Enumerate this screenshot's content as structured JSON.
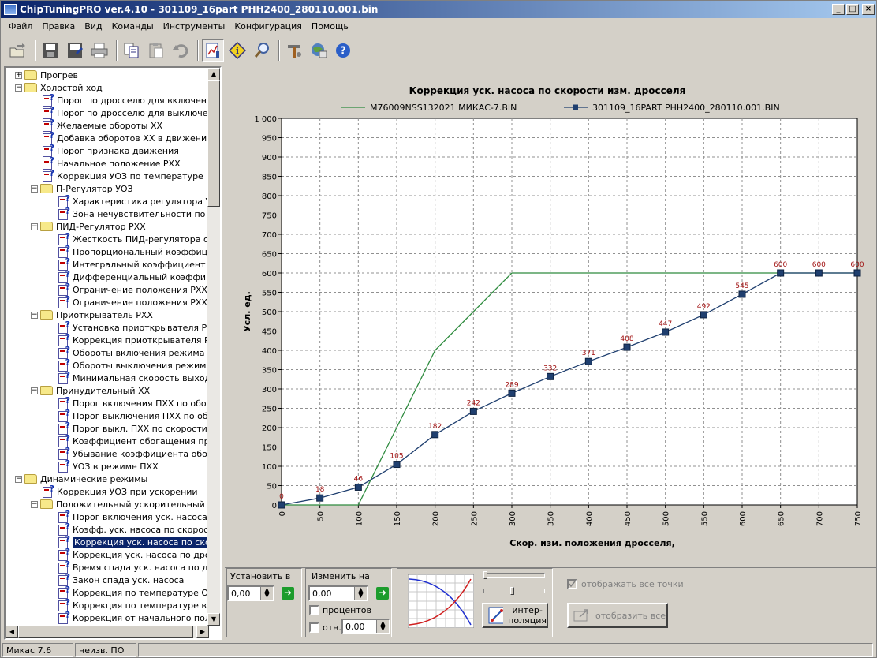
{
  "window": {
    "title": "ChipTuningPRO ver.4.10 - 301109_16part РНН2400_280110.001.bin",
    "controls": [
      "_",
      "□",
      "×"
    ]
  },
  "menu": [
    "Файл",
    "Правка",
    "Вид",
    "Команды",
    "Инструменты",
    "Конфигурация",
    "Помощь"
  ],
  "toolbar": [
    "open-icon",
    "save-icon",
    "save-as-icon",
    "print-icon",
    "copy-icon",
    "paste-icon",
    "undo-icon",
    "chart-icon",
    "info-icon",
    "zoom-icon",
    "tools-icon",
    "network-icon",
    "help-icon"
  ],
  "tree": [
    {
      "level": 0,
      "type": "folder",
      "expander": "+",
      "label": "Прогрев"
    },
    {
      "level": 0,
      "type": "folder",
      "expander": "−",
      "label": "Холостой ход"
    },
    {
      "level": 1,
      "type": "param",
      "label": "Порог по дросселю для включени"
    },
    {
      "level": 1,
      "type": "param",
      "label": "Порог по дросселю для выключен"
    },
    {
      "level": 1,
      "type": "param",
      "label": "Желаемые обороты ХХ"
    },
    {
      "level": 1,
      "type": "param",
      "label": "Добавка оборотов ХХ в движени"
    },
    {
      "level": 1,
      "type": "param",
      "label": "Порог признака движения"
    },
    {
      "level": 1,
      "type": "param",
      "label": "Начальное положение РХХ"
    },
    {
      "level": 1,
      "type": "param",
      "label": "Коррекция УОЗ по температуре О"
    },
    {
      "level": 1,
      "type": "folder",
      "expander": "−",
      "label": "П-Регулятор УОЗ"
    },
    {
      "level": 2,
      "type": "param",
      "label": "Характеристика регулятора У"
    },
    {
      "level": 2,
      "type": "param",
      "label": "Зона нечувствительности по о"
    },
    {
      "level": 1,
      "type": "folder",
      "expander": "−",
      "label": "ПИД-Регулятор РХХ"
    },
    {
      "level": 2,
      "type": "param",
      "label": "Жесткость ПИД-регулятора о"
    },
    {
      "level": 2,
      "type": "param",
      "label": "Пропорциональный коэффици"
    },
    {
      "level": 2,
      "type": "param",
      "label": "Интегральный коэффициент р"
    },
    {
      "level": 2,
      "type": "param",
      "label": "Дифференциальный коэффици"
    },
    {
      "level": 2,
      "type": "param",
      "label": "Ограничение положения РХХ"
    },
    {
      "level": 2,
      "type": "param",
      "label": "Ограничение положения РХХ"
    },
    {
      "level": 1,
      "type": "folder",
      "expander": "−",
      "label": "Приоткрыватель РХХ"
    },
    {
      "level": 2,
      "type": "param",
      "label": "Установка приоткрывателя Р"
    },
    {
      "level": 2,
      "type": "param",
      "label": "Коррекция приоткрывателя Р"
    },
    {
      "level": 2,
      "type": "param",
      "label": "Обороты включения режима г"
    },
    {
      "level": 2,
      "type": "param",
      "label": "Обороты выключения режима"
    },
    {
      "level": 2,
      "type": "param",
      "label": "Минимальная скорость выход"
    },
    {
      "level": 1,
      "type": "folder",
      "expander": "−",
      "label": "Принудительный ХХ"
    },
    {
      "level": 2,
      "type": "param",
      "label": "Порог включения ПХХ по обор"
    },
    {
      "level": 2,
      "type": "param",
      "label": "Порог выключения ПХХ по об"
    },
    {
      "level": 2,
      "type": "param",
      "label": "Порог выкл. ПХХ по скорости"
    },
    {
      "level": 2,
      "type": "param",
      "label": "Коэффициент обогащения при"
    },
    {
      "level": 2,
      "type": "param",
      "label": "Убывание коэффициента обо"
    },
    {
      "level": 2,
      "type": "param",
      "label": "УОЗ в режиме ПХХ"
    },
    {
      "level": 0,
      "type": "folder",
      "expander": "−",
      "label": "Динамические режимы"
    },
    {
      "level": 1,
      "type": "param",
      "label": "Коррекция УОЗ при ускорении"
    },
    {
      "level": 1,
      "type": "folder",
      "expander": "−",
      "label": "Положительный ускорительный н"
    },
    {
      "level": 2,
      "type": "param",
      "label": "Порог включения уск. насоса"
    },
    {
      "level": 2,
      "type": "param",
      "label": "Коэфф. уск. насоса по скорос"
    },
    {
      "level": 2,
      "type": "param",
      "label": "Коррекция уск. насоса по скор",
      "selected": true
    },
    {
      "level": 2,
      "type": "param",
      "label": "Коррекция уск. насоса по дро"
    },
    {
      "level": 2,
      "type": "param",
      "label": "Время спада уск. насоса по д"
    },
    {
      "level": 2,
      "type": "param",
      "label": "Закон спада уск. насоса"
    },
    {
      "level": 2,
      "type": "param",
      "label": "Коррекция по температуре ОХ"
    },
    {
      "level": 2,
      "type": "param",
      "label": "Коррекция по температуре во"
    },
    {
      "level": 2,
      "type": "param",
      "label": "Коррекция от начального пол"
    }
  ],
  "chart_data": {
    "type": "line",
    "title": "Коррекция уск. насоса по скорости изм. дросселя",
    "xlabel": "Скор. изм. положения дросселя,",
    "ylabel": "Усл. ед.",
    "xlim": [
      0,
      750
    ],
    "ylim": [
      0,
      1000
    ],
    "x_ticks": [
      "0",
      "50",
      "100",
      "150",
      "200",
      "250",
      "300",
      "350",
      "400",
      "450",
      "500",
      "550",
      "600",
      "650",
      "700",
      "750"
    ],
    "y_ticks": [
      "0",
      "50",
      "100",
      "150",
      "200",
      "250",
      "300",
      "350",
      "400",
      "450",
      "500",
      "550",
      "600",
      "650",
      "700",
      "750",
      "800",
      "850",
      "900",
      "950",
      "1 000"
    ],
    "grid": true,
    "legend_position": "top",
    "series": [
      {
        "name": "M76009NSS132021 МИКАС-7.BIN",
        "color": "#2e8b3e",
        "markers": false,
        "x": [
          0,
          50,
          100,
          150,
          200,
          250,
          300,
          350,
          400,
          450,
          500,
          550,
          600,
          650,
          700,
          750
        ],
        "y": [
          0,
          0,
          0,
          200,
          400,
          500,
          600,
          600,
          600,
          600,
          600,
          600,
          600,
          600,
          600,
          600
        ]
      },
      {
        "name": "301109_16PART РНН2400_280110.001.BIN",
        "color": "#1f3f6f",
        "markers": true,
        "x": [
          0,
          50,
          100,
          150,
          200,
          250,
          300,
          350,
          400,
          450,
          500,
          550,
          600,
          650,
          700,
          750
        ],
        "y": [
          0,
          18,
          46,
          105,
          182,
          242,
          289,
          332,
          371,
          408,
          447,
          492,
          545,
          600,
          600,
          600
        ],
        "labels": [
          "0",
          "18",
          "46",
          "105",
          "182",
          "242",
          "289",
          "332",
          "371",
          "408",
          "447",
          "492",
          "545",
          "600",
          "600",
          "600"
        ]
      }
    ]
  },
  "controls": {
    "set_label": "Установить в",
    "set_value": "0,00",
    "change_label": "Изменить на",
    "change_value": "0,00",
    "percent_label": "процентов",
    "rel_label": "отн.",
    "rel_value": "0,00",
    "interp_label_1": "интер-",
    "interp_label_2": "поляция",
    "show_points_label": "отображать все точки",
    "show_all_label": "отобразить все"
  },
  "status": [
    "Микас 7.6",
    "неизв. ПО",
    ""
  ]
}
